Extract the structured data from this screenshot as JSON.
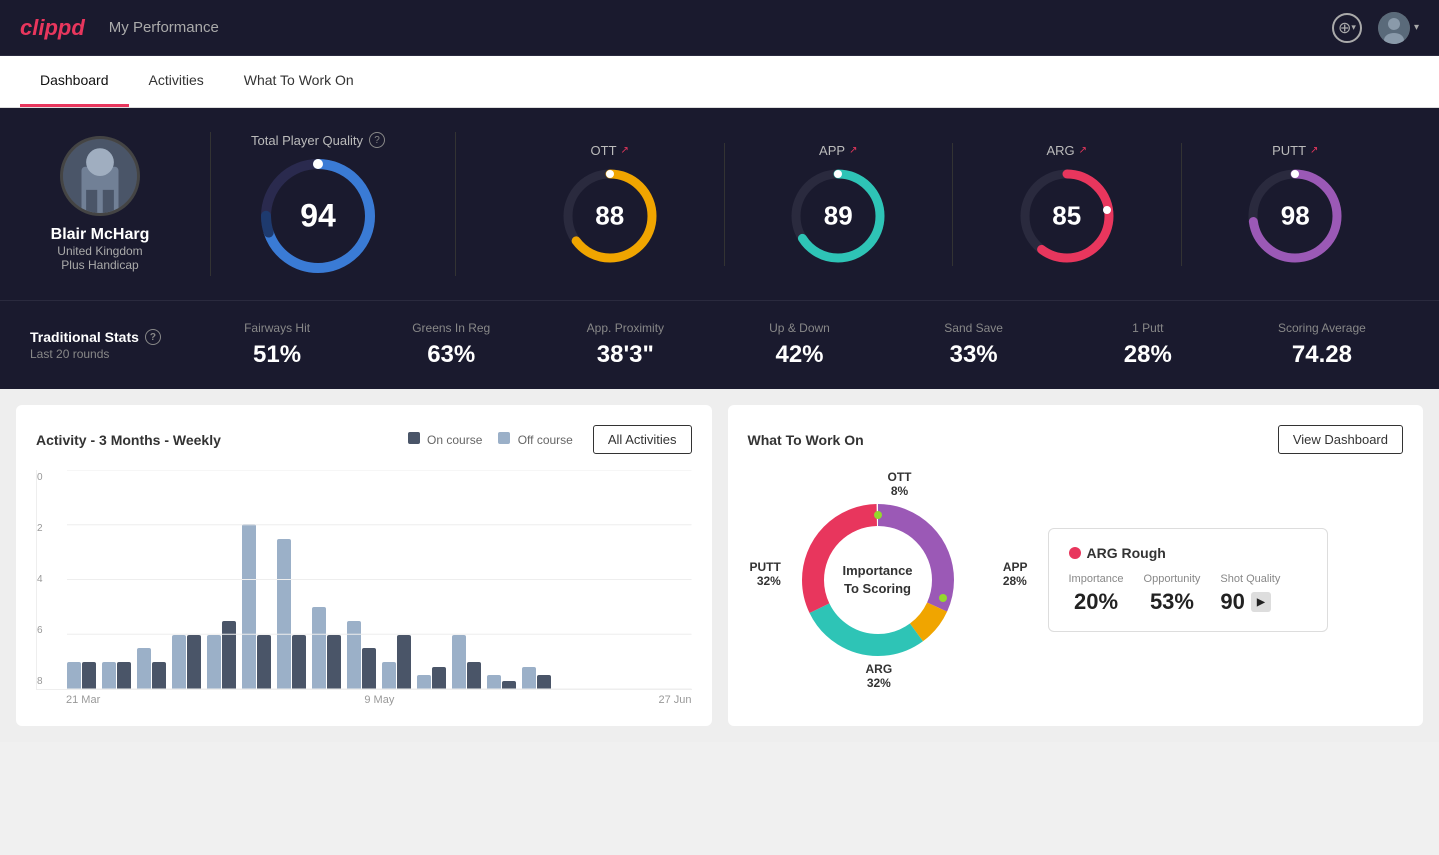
{
  "app": {
    "logo": "clippd",
    "header_title": "My Performance"
  },
  "nav": {
    "items": [
      {
        "label": "Dashboard",
        "active": true
      },
      {
        "label": "Activities",
        "active": false
      },
      {
        "label": "What To Work On",
        "active": false
      }
    ]
  },
  "player": {
    "name": "Blair McHarg",
    "country": "United Kingdom",
    "handicap": "Plus Handicap"
  },
  "scores": {
    "tpq": {
      "label": "Total Player Quality",
      "value": "94",
      "color": "#3a7bd5"
    },
    "ott": {
      "label": "OTT",
      "value": "88",
      "color": "#f0a500"
    },
    "app": {
      "label": "APP",
      "value": "89",
      "color": "#2ec4b6"
    },
    "arg": {
      "label": "ARG",
      "value": "85",
      "color": "#e8365d"
    },
    "putt": {
      "label": "PUTT",
      "value": "98",
      "color": "#9b59b6"
    }
  },
  "traditional_stats": {
    "title": "Traditional Stats",
    "subtitle": "Last 20 rounds",
    "items": [
      {
        "label": "Fairways Hit",
        "value": "51%"
      },
      {
        "label": "Greens In Reg",
        "value": "63%"
      },
      {
        "label": "App. Proximity",
        "value": "38'3\""
      },
      {
        "label": "Up & Down",
        "value": "42%"
      },
      {
        "label": "Sand Save",
        "value": "33%"
      },
      {
        "label": "1 Putt",
        "value": "28%"
      },
      {
        "label": "Scoring Average",
        "value": "74.28"
      }
    ]
  },
  "activity_chart": {
    "title": "Activity - 3 Months - Weekly",
    "legend": {
      "on_course": "On course",
      "off_course": "Off course"
    },
    "all_activities_btn": "All Activities",
    "x_labels": [
      "21 Mar",
      "9 May",
      "27 Jun"
    ],
    "y_labels": [
      "0",
      "2",
      "4",
      "6",
      "8"
    ],
    "bars": [
      {
        "on": 1,
        "off": 1
      },
      {
        "on": 1,
        "off": 1
      },
      {
        "on": 1,
        "off": 1.5
      },
      {
        "on": 2,
        "off": 2
      },
      {
        "on": 2.5,
        "off": 2
      },
      {
        "on": 2,
        "off": 6
      },
      {
        "on": 2,
        "off": 5.5
      },
      {
        "on": 2,
        "off": 3
      },
      {
        "on": 1.5,
        "off": 2.5
      },
      {
        "on": 2,
        "off": 1
      },
      {
        "on": 0.8,
        "off": 0.5
      },
      {
        "on": 1,
        "off": 2
      },
      {
        "on": 0.3,
        "off": 0.5
      },
      {
        "on": 0.5,
        "off": 0.8
      }
    ]
  },
  "what_to_work_on": {
    "title": "What To Work On",
    "view_dashboard_btn": "View Dashboard",
    "donut_center": "Importance\nTo Scoring",
    "segments": [
      {
        "label": "OTT",
        "pct": "8%",
        "color": "#f0a500"
      },
      {
        "label": "APP",
        "pct": "28%",
        "color": "#2ec4b6"
      },
      {
        "label": "ARG",
        "pct": "32%",
        "color": "#e8365d"
      },
      {
        "label": "PUTT",
        "pct": "32%",
        "color": "#9b59b6"
      }
    ],
    "info_card": {
      "title": "ARG Rough",
      "metrics": [
        {
          "label": "Importance",
          "value": "20%"
        },
        {
          "label": "Opportunity",
          "value": "53%"
        },
        {
          "label": "Shot Quality",
          "value": "90"
        }
      ]
    }
  }
}
